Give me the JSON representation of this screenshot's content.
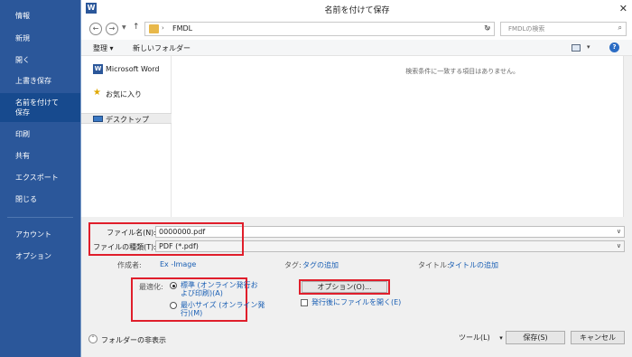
{
  "sidebar": {
    "items": [
      {
        "label": "情報"
      },
      {
        "label": "新規"
      },
      {
        "label": "開く"
      },
      {
        "label": "上書き保存"
      },
      {
        "label": "名前を付けて\n保存"
      },
      {
        "label": "印刷"
      },
      {
        "label": "共有"
      },
      {
        "label": "エクスポート"
      },
      {
        "label": "閉じる"
      },
      {
        "label": "アカウント"
      },
      {
        "label": "オプション"
      }
    ]
  },
  "dialog": {
    "title": "名前を付けて保存",
    "app_icon": "W",
    "address": "FMDL",
    "search_placeholder": "FMDLの検索",
    "toolbar": {
      "organize": "整理 ▾",
      "new_folder": "新しいフォルダー"
    },
    "nav": {
      "word": "Microsoft Word",
      "favorites": "お気に入り",
      "desktop": "デスクトップ"
    },
    "empty_message": "検索条件に一致する項目はありません。",
    "file_name_label": "ファイル名(N):",
    "file_name_value": "0000000.pdf",
    "file_type_label": "ファイルの種類(T):",
    "file_type_value": "PDF (*.pdf)",
    "author_label": "作成者:",
    "author_value": "Ex -Image",
    "tags_label": "タグ:",
    "tags_value": "タグの追加",
    "title_label": "タイトル:",
    "title_value": "タイトルの追加",
    "optimize_label": "最適化:",
    "optimize_standard": "標準 (オンライン発行お\nよび印刷)(A)",
    "optimize_minimum": "最小サイズ (オンライン発\n行)(M)",
    "options_button": "オプション(O)...",
    "open_after_publish": "発行後にファイルを開く(E)",
    "hide_folders": "フォルダーの非表示",
    "tools_button": "ツール(L)",
    "save_button": "保存(S)",
    "cancel_button": "キャンセル"
  }
}
